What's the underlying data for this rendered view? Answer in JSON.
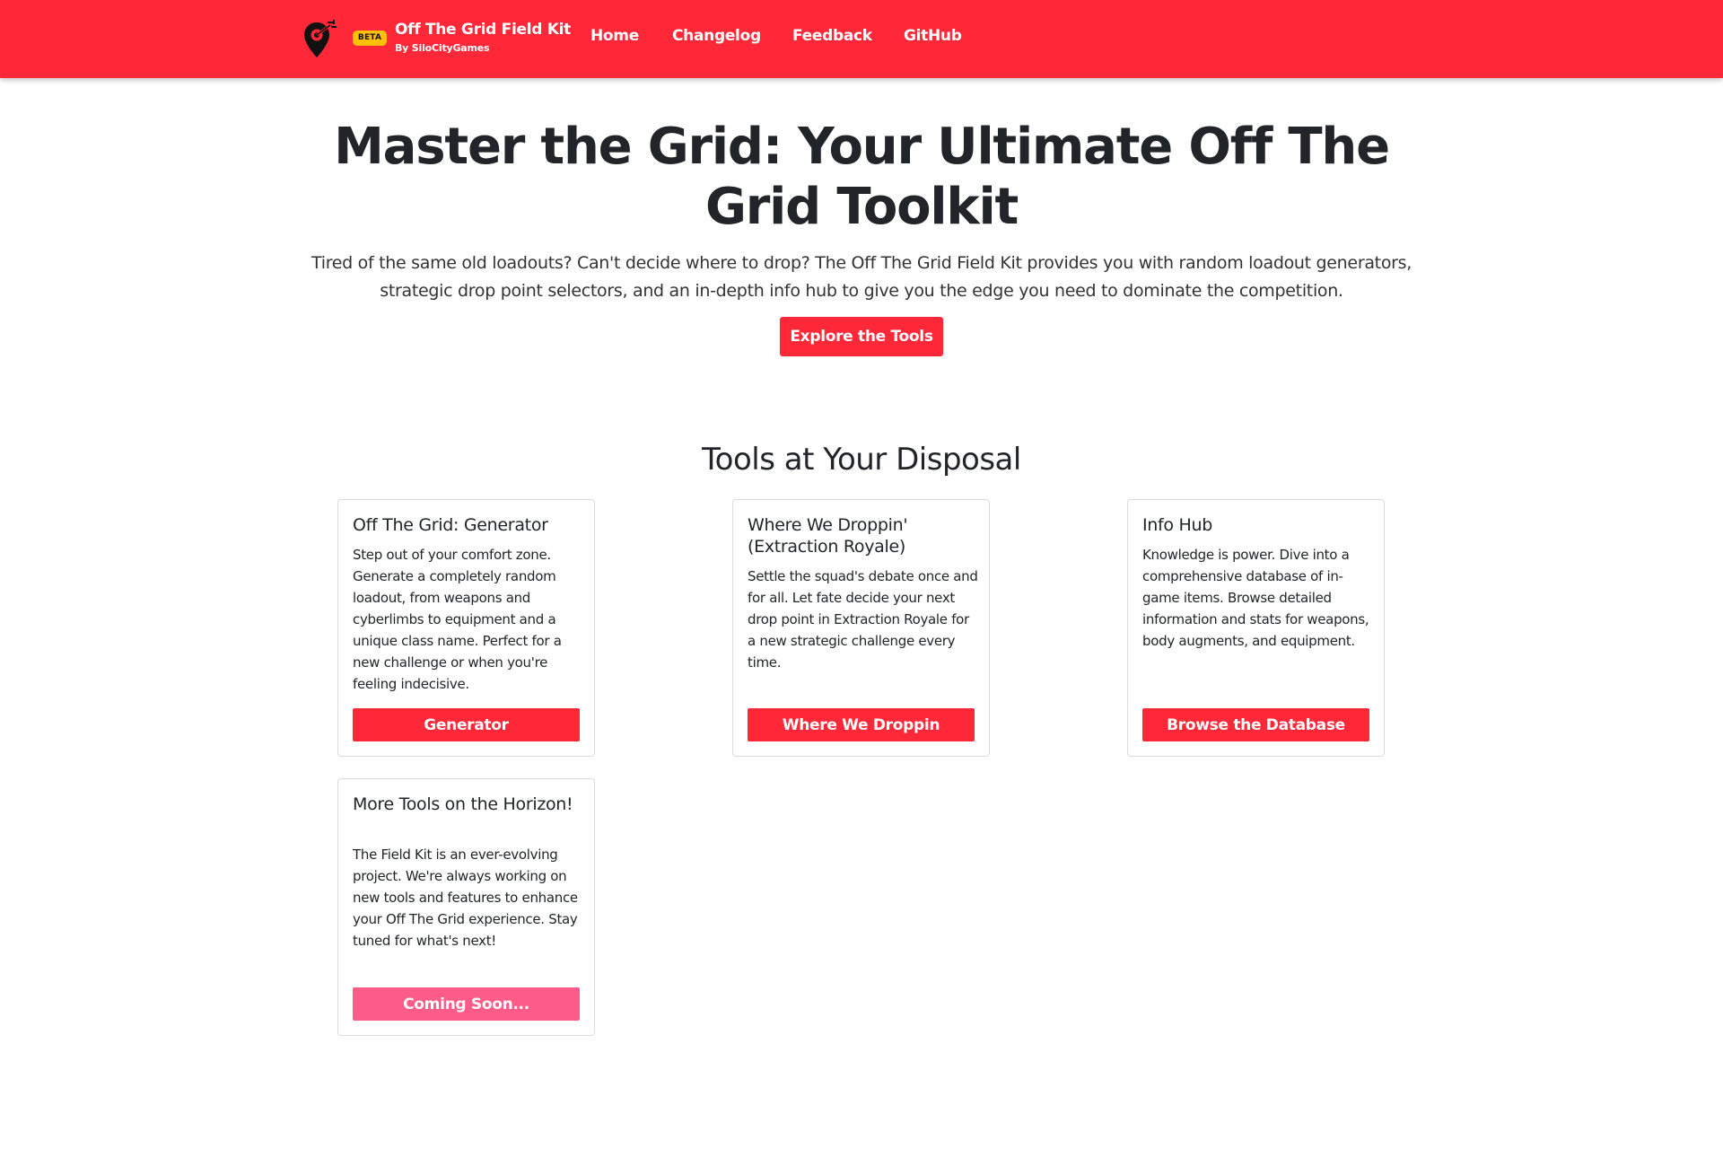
{
  "navbar": {
    "beta_badge": "BETA",
    "brand_title": "Off The Grid Field Kit",
    "brand_subtitle": "By SiloCityGames",
    "links": [
      "Home",
      "Changelog",
      "Feedback",
      "GitHub"
    ],
    "logo_icon": "map-pin-target-icon",
    "colors": {
      "navbar_bg": "#fe2839",
      "badge_bg": "#ffc107"
    }
  },
  "hero": {
    "title": "Master the Grid: Your Ultimate Off The Grid Toolkit",
    "description": "Tired of the same old loadouts? Can't decide where to drop? The Off The Grid Field Kit provides you with random loadout generators, strategic drop point selectors, and an in-depth info hub to give you the edge you need to dominate the competition.",
    "cta_label": "Explore the Tools"
  },
  "tools": {
    "heading": "Tools at Your Disposal",
    "cards": [
      {
        "title": "Off The Grid: Generator",
        "text": "Step out of your comfort zone. Generate a completely random loadout, from weapons and cyberlimbs to equipment and a unique class name. Perfect for a new challenge or when you're feeling indecisive.",
        "button": "Generator"
      },
      {
        "title": "Where We Droppin' (Extraction Royale)",
        "text": "Settle the squad's debate once and for all. Let fate decide your next drop point in Extraction Royale for a new strategic challenge every time.",
        "button": "Where We Droppin"
      },
      {
        "title": "Info Hub",
        "text": "Knowledge is power. Dive into a comprehensive database of in-game items. Browse detailed information and stats for weapons, body augments, and equipment.",
        "button": "Browse the Database"
      },
      {
        "title": "More Tools on the Horizon!",
        "text": "The Field Kit is an ever-evolving project. We're always working on new tools and features to enhance your Off The Grid experience. Stay tuned for what's next!",
        "button": "Coming Soon..."
      }
    ],
    "colors": {
      "button_bg": "#fe2839",
      "disabled_button_bg": "#fe5c88"
    }
  }
}
